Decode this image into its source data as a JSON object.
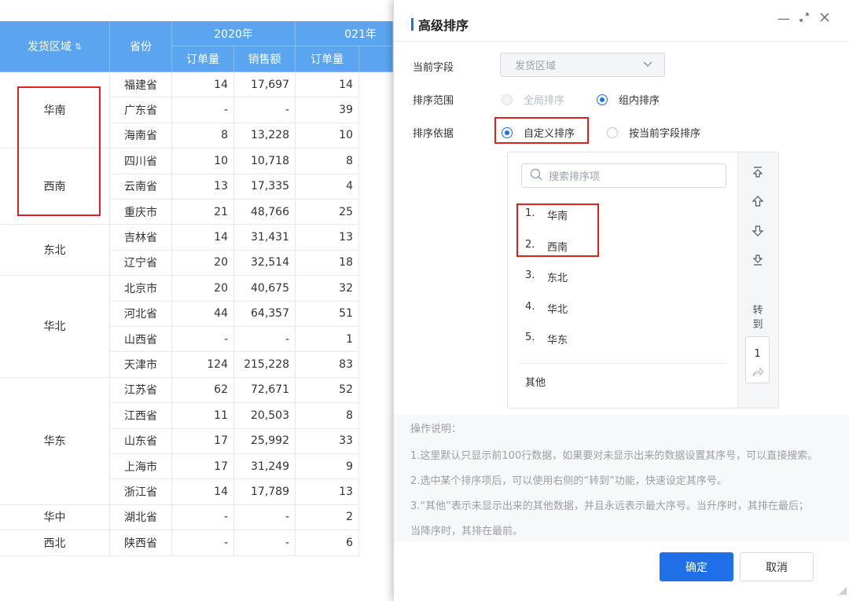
{
  "table": {
    "header": {
      "region": "发货区域",
      "province": "省份",
      "year1": "2020年",
      "year2": "021年",
      "orders": "订单量",
      "sales": "销售额",
      "orders2": "订单量"
    },
    "regions": [
      "华南",
      "西南",
      "东北",
      "华北",
      "华东",
      "华中",
      "西北"
    ],
    "rows": [
      {
        "province": "福建省",
        "orders": "14",
        "sales": "17,697",
        "orders2": "14"
      },
      {
        "province": "广东省",
        "orders": "-",
        "sales": "-",
        "orders2": "39"
      },
      {
        "province": "海南省",
        "orders": "8",
        "sales": "13,228",
        "orders2": "10"
      },
      {
        "province": "四川省",
        "orders": "10",
        "sales": "10,718",
        "orders2": "8"
      },
      {
        "province": "云南省",
        "orders": "13",
        "sales": "17,335",
        "orders2": "4"
      },
      {
        "province": "重庆市",
        "orders": "21",
        "sales": "48,766",
        "orders2": "25"
      },
      {
        "province": "吉林省",
        "orders": "14",
        "sales": "31,431",
        "orders2": "13"
      },
      {
        "province": "辽宁省",
        "orders": "20",
        "sales": "32,514",
        "orders2": "18"
      },
      {
        "province": "北京市",
        "orders": "20",
        "sales": "40,675",
        "orders2": "32"
      },
      {
        "province": "河北省",
        "orders": "44",
        "sales": "64,357",
        "orders2": "51"
      },
      {
        "province": "山西省",
        "orders": "-",
        "sales": "-",
        "orders2": "1"
      },
      {
        "province": "天津市",
        "orders": "124",
        "sales": "215,228",
        "orders2": "83"
      },
      {
        "province": "江苏省",
        "orders": "62",
        "sales": "72,671",
        "orders2": "52"
      },
      {
        "province": "江西省",
        "orders": "11",
        "sales": "20,503",
        "orders2": "8"
      },
      {
        "province": "山东省",
        "orders": "17",
        "sales": "25,992",
        "orders2": "33"
      },
      {
        "province": "上海市",
        "orders": "17",
        "sales": "31,249",
        "orders2": "9"
      },
      {
        "province": "浙江省",
        "orders": "14",
        "sales": "17,789",
        "orders2": "13"
      },
      {
        "province": "湖北省",
        "orders": "-",
        "sales": "-",
        "orders2": "2"
      },
      {
        "province": "陕西省",
        "orders": "-",
        "sales": "-",
        "orders2": "6"
      }
    ]
  },
  "dialog": {
    "title": "高级排序",
    "current_field_label": "当前字段",
    "current_field_value": "发货区域",
    "range_label": "排序范围",
    "range_global": "全局排序",
    "range_group": "组内排序",
    "basis_label": "排序依据",
    "basis_custom": "自定义排序",
    "basis_field": "按当前字段排序",
    "search_placeholder": "搜索排序项",
    "items": [
      {
        "idx": "1.",
        "label": "华南"
      },
      {
        "idx": "2.",
        "label": "西南"
      },
      {
        "idx": "3.",
        "label": "东北"
      },
      {
        "idx": "4.",
        "label": "华北"
      },
      {
        "idx": "5.",
        "label": "华东"
      }
    ],
    "other_label": "其他",
    "goto_label": "转到",
    "goto_value": "1",
    "help_title": "操作说明：",
    "help_1": "1.这里默认只显示前100行数据，如果要对未显示出来的数据设置其序号，可以直接搜索。",
    "help_2": "2.选中某个排序项后，可以使用右侧的“转到”功能，快速设定其序号。",
    "help_3": "3.“其他”表示未显示出来的其他数据，并且永远表示最大序号。当升序时，其排在最后；",
    "help_4": "当降序时，其排在最前。",
    "ok": "确定",
    "cancel": "取消"
  },
  "colors": {
    "header_bg": "#5ba5f0",
    "accent": "#1e6fe8",
    "highlight_border": "#e02020"
  }
}
